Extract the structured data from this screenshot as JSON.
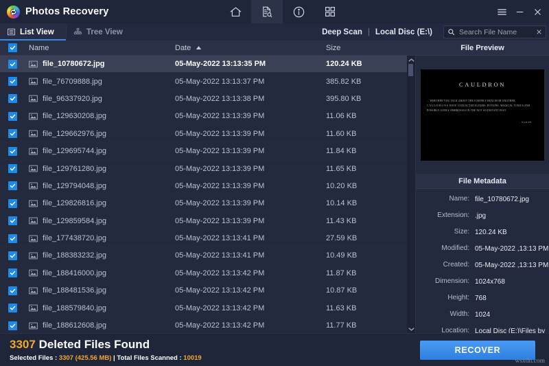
{
  "window": {
    "app_title": "Photos Recovery",
    "logo_icon": "recycle-circle-logo",
    "toolbar": [
      {
        "name": "home-icon",
        "label": "Home"
      },
      {
        "name": "scan-document-icon",
        "label": "Scan",
        "active": true
      },
      {
        "name": "info-icon",
        "label": "Info"
      },
      {
        "name": "grid-view-icon",
        "label": "Grid"
      }
    ],
    "controls": {
      "menu": "hamburger-menu-icon",
      "minimize": "minimize-icon",
      "close": "close-icon"
    }
  },
  "viewbar": {
    "tabs": [
      {
        "label": "List View",
        "icon": "list-view-icon",
        "active": true
      },
      {
        "label": "Tree View",
        "icon": "tree-view-icon",
        "active": false
      }
    ],
    "scan_mode": "Deep Scan",
    "divider": "|",
    "drive": "Local Disc (E:\\)",
    "search": {
      "placeholder": "Search File Name",
      "value": "",
      "icon": "search-icon",
      "clear_icon": "clear-icon"
    }
  },
  "table": {
    "columns": {
      "name": "Name",
      "date": "Date",
      "size": "Size"
    },
    "sort": {
      "column": "Date",
      "direction": "ascending",
      "icon": "sort-ascending-icon"
    },
    "header_checkbox_checked": true,
    "rows": [
      {
        "name": "file_10780672.jpg",
        "date": "05-May-2022 13:13:35 PM",
        "size": "120.24 KB",
        "checked": true,
        "selected": true
      },
      {
        "name": "file_76709888.jpg",
        "date": "05-May-2022 13:13:37 PM",
        "size": "385.82 KB",
        "checked": true,
        "selected": false
      },
      {
        "name": "file_96337920.jpg",
        "date": "05-May-2022 13:13:38 PM",
        "size": "395.80 KB",
        "checked": true,
        "selected": false
      },
      {
        "name": "file_129630208.jpg",
        "date": "05-May-2022 13:13:39 PM",
        "size": "11.06 KB",
        "checked": true,
        "selected": false
      },
      {
        "name": "file_129662976.jpg",
        "date": "05-May-2022 13:13:39 PM",
        "size": "11.60 KB",
        "checked": true,
        "selected": false
      },
      {
        "name": "file_129695744.jpg",
        "date": "05-May-2022 13:13:39 PM",
        "size": "11.84 KB",
        "checked": true,
        "selected": false
      },
      {
        "name": "file_129761280.jpg",
        "date": "05-May-2022 13:13:39 PM",
        "size": "11.65 KB",
        "checked": true,
        "selected": false
      },
      {
        "name": "file_129794048.jpg",
        "date": "05-May-2022 13:13:39 PM",
        "size": "10.20 KB",
        "checked": true,
        "selected": false
      },
      {
        "name": "file_129826816.jpg",
        "date": "05-May-2022 13:13:39 PM",
        "size": "10.14 KB",
        "checked": true,
        "selected": false
      },
      {
        "name": "file_129859584.jpg",
        "date": "05-May-2022 13:13:39 PM",
        "size": "11.43 KB",
        "checked": true,
        "selected": false
      },
      {
        "name": "file_177438720.jpg",
        "date": "05-May-2022 13:13:41 PM",
        "size": "27.59 KB",
        "checked": true,
        "selected": false
      },
      {
        "name": "file_188383232.jpg",
        "date": "05-May-2022 13:13:41 PM",
        "size": "10.49 KB",
        "checked": true,
        "selected": false
      },
      {
        "name": "file_188416000.jpg",
        "date": "05-May-2022 13:13:42 PM",
        "size": "11.87 KB",
        "checked": true,
        "selected": false
      },
      {
        "name": "file_188481536.jpg",
        "date": "05-May-2022 13:13:42 PM",
        "size": "10.87 KB",
        "checked": true,
        "selected": false
      },
      {
        "name": "file_188579840.jpg",
        "date": "05-May-2022 13:13:42 PM",
        "size": "11.63 KB",
        "checked": true,
        "selected": false
      },
      {
        "name": "file_188612608.jpg",
        "date": "05-May-2022 13:13:42 PM",
        "size": "11.77 KB",
        "checked": true,
        "selected": false
      }
    ]
  },
  "preview": {
    "title": "File Preview",
    "image": {
      "heading": "CAULDRON",
      "body_1": "... WHETHER YOU TALK ABOUT THE EARTHLY REALM OR ANOTHER,",
      "body_word": "CAULDRONS",
      "body_2": "HAVE CONCOCTED ELIXIRS, POTIONS, MAGICAL",
      "body_3": "TONICS AND POSSIBLY GODLY AMBROSIAS IN THE NOT SO DISTANT",
      "body_4": "PAST.",
      "signature": "- SARAH "
    }
  },
  "metadata": {
    "title": "File Metadata",
    "fields": [
      {
        "key": "Name:",
        "value": "file_10780672.jpg"
      },
      {
        "key": "Extension:",
        "value": ".jpg"
      },
      {
        "key": "Size:",
        "value": "120.24 KB"
      },
      {
        "key": "Modified:",
        "value": "05-May-2022 ,13:13 PM"
      },
      {
        "key": "Created:",
        "value": "05-May-2022 ,13:13 PM"
      },
      {
        "key": "Dimension:",
        "value": "1024x768"
      },
      {
        "key": "Height:",
        "value": "768"
      },
      {
        "key": "Width:",
        "value": "1024"
      },
      {
        "key": "Location:",
        "value": "Local Disc (E:)\\Files by content\\.jpg"
      }
    ]
  },
  "footer": {
    "found_count": "3307",
    "found_label": "Deleted Files Found",
    "selected_prefix": "Selected Files : ",
    "selected_count": "3307",
    "selected_size": "(425.56 MB)",
    "sep": " | ",
    "scanned_prefix": "Total Files Scanned : ",
    "scanned_count": "10019",
    "recover_label": "RECOVER",
    "watermark": "wsxdn.com"
  },
  "colors": {
    "accent_blue": "#3f8ae0",
    "amber": "#f0a830",
    "checkbox_blue": "#1f8ae8",
    "background": "#242a3d"
  }
}
